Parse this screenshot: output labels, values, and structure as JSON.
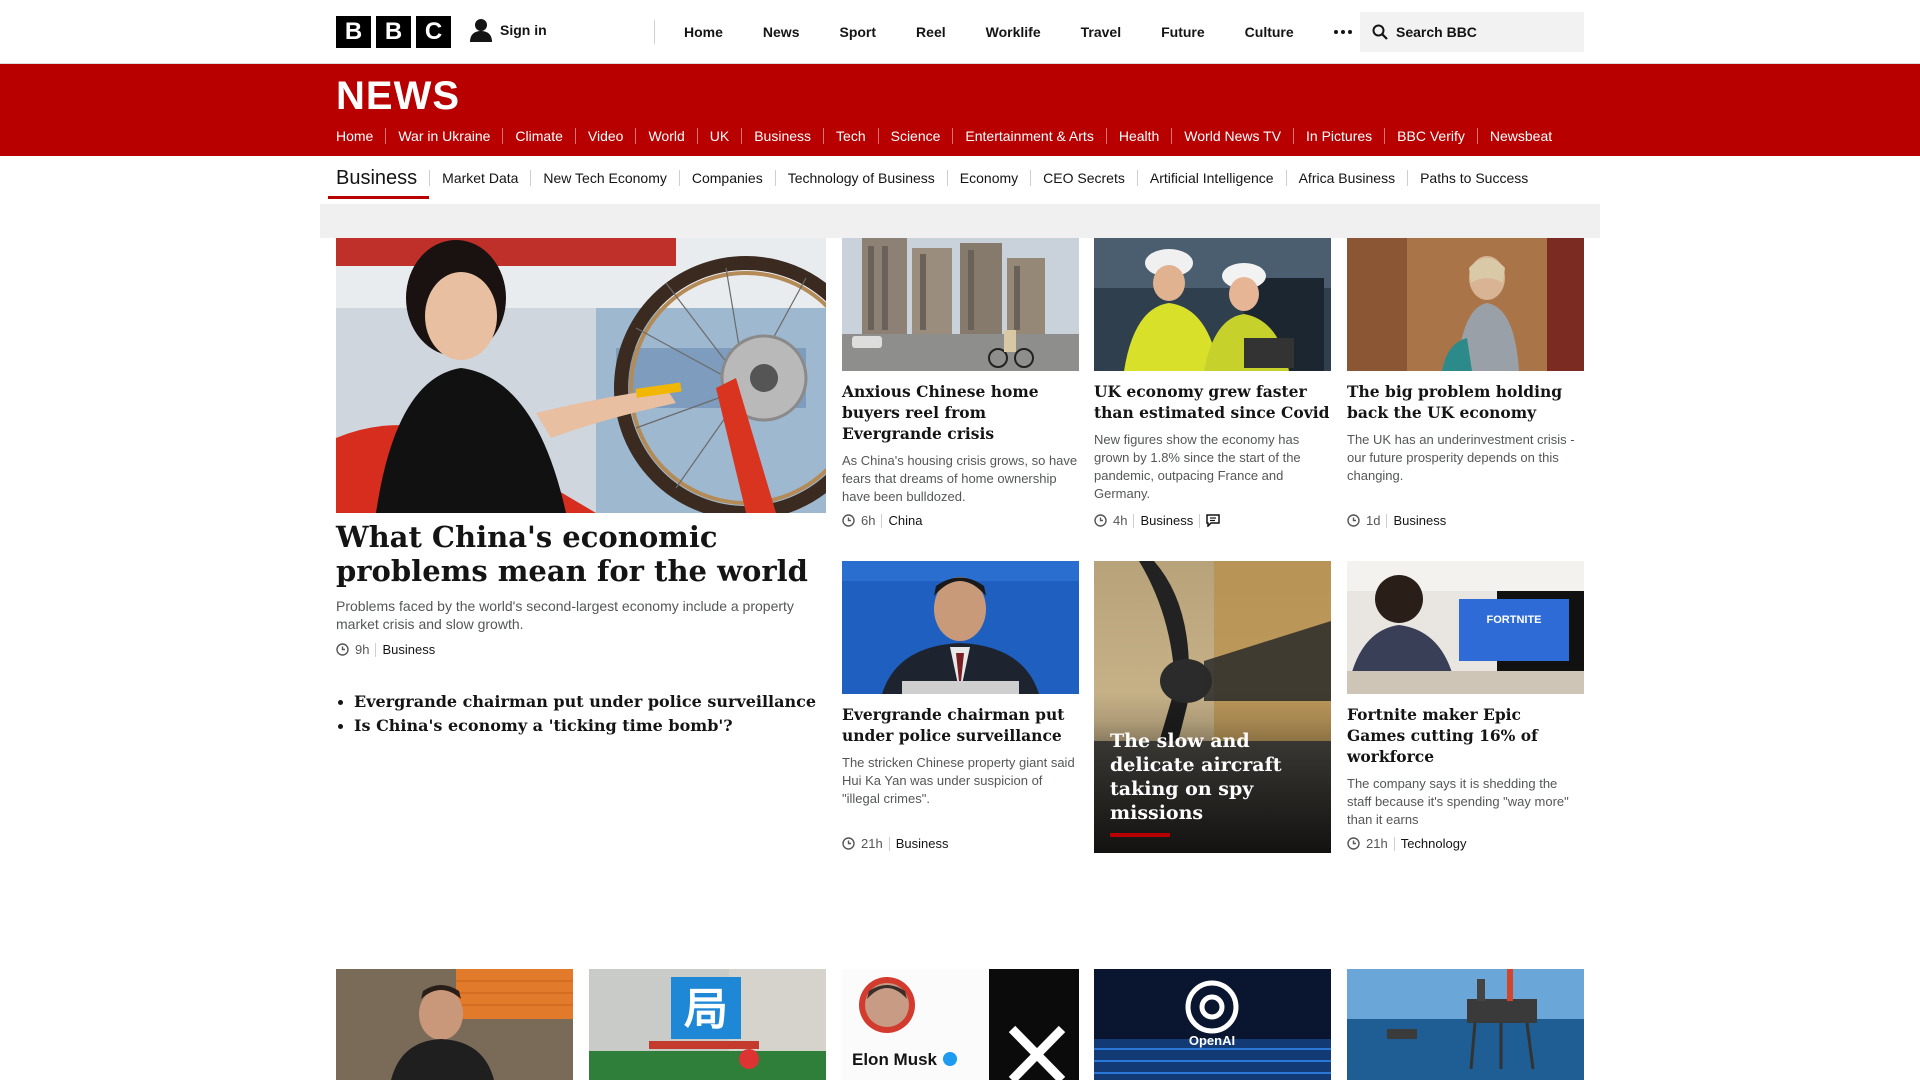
{
  "brand": {
    "logo_letters": [
      "B",
      "B",
      "C"
    ]
  },
  "header": {
    "sign_in": "Sign in",
    "nav": [
      "Home",
      "News",
      "Sport",
      "Reel",
      "Worklife",
      "Travel",
      "Future",
      "Culture"
    ],
    "search_placeholder": "Search BBC"
  },
  "news_band": {
    "title": "NEWS",
    "nav": [
      "Home",
      "War in Ukraine",
      "Climate",
      "Video",
      "World",
      "UK",
      "Business",
      "Tech",
      "Science",
      "Entertainment & Arts",
      "Health",
      "World News TV",
      "In Pictures",
      "BBC Verify",
      "Newsbeat"
    ],
    "active": "Business",
    "accent_color": "#b80000"
  },
  "subnav": {
    "current": "Business",
    "items": [
      "Market Data",
      "New Tech Economy",
      "Companies",
      "Technology of Business",
      "Economy",
      "CEO Secrets",
      "Artificial Intelligence",
      "Africa Business",
      "Paths to Success"
    ]
  },
  "lead": {
    "title": "What China's economic problems mean for the world",
    "summary": "Problems faced by the world's second-largest economy include a property market crisis and slow growth.",
    "time": "9h",
    "category": "Business",
    "related": [
      "Evergrande chairman put under police surveillance",
      "Is China's economy a 'ticking time bomb'?"
    ]
  },
  "cards": [
    {
      "title": "Anxious Chinese home buyers reel from Evergrande crisis",
      "summary": "As China's housing crisis grows, so have fears that dreams of home ownership have been bulldozed.",
      "time": "6h",
      "category": "China"
    },
    {
      "title": "UK economy grew faster than estimated since Covid",
      "summary": "New figures show the economy has grown by 1.8% since the start of the pandemic, outpacing France and Germany.",
      "time": "4h",
      "category": "Business",
      "has_comments": true
    },
    {
      "title": "The big problem holding back the UK economy",
      "summary": "The UK has an underinvestment crisis - our future prosperity depends on this changing.",
      "time": "1d",
      "category": "Business"
    },
    {
      "title": "Evergrande chairman put under police surveillance",
      "summary": "The stricken Chinese property giant said Hui Ka Yan was under suspicion of \"illegal crimes\".",
      "time": "21h",
      "category": "Business"
    },
    {
      "title": "Fortnite maker Epic Games cutting 16% of workforce",
      "summary": "The company says it is shedding the staff because it's spending \"way more\" than it earns",
      "time": "21h",
      "category": "Technology"
    }
  ],
  "feature": {
    "title": "The slow and delicate aircraft taking on spy missions"
  },
  "image_text": {
    "fortnite": "FORTNITE",
    "musk_name": "Elon Musk",
    "openai": "OpenAI",
    "sign_char": "局"
  }
}
